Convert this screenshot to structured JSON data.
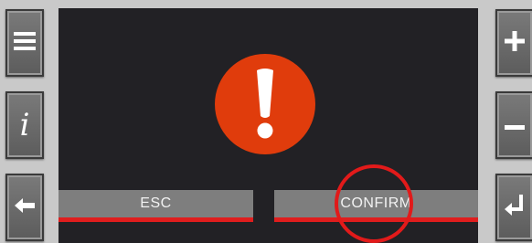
{
  "colors": {
    "bezel": "#c9c9c9",
    "screen_background": "#222125",
    "alert": "#e03c0c",
    "button_fill": "#7e7e7e",
    "button_underline": "#e01d1d",
    "highlight": "#e21a1a"
  },
  "hardware_buttons": {
    "left": [
      {
        "icon": "menu-icon"
      },
      {
        "icon": "info-icon",
        "glyph": "i"
      },
      {
        "icon": "back-arrow-icon"
      }
    ],
    "right": [
      {
        "icon": "plus-icon"
      },
      {
        "icon": "minus-icon"
      },
      {
        "icon": "enter-icon"
      }
    ]
  },
  "dialog": {
    "icon": "exclamation-icon",
    "esc_label": "ESC",
    "confirm_label": "CONFIRM",
    "highlighted_button": "confirm"
  }
}
